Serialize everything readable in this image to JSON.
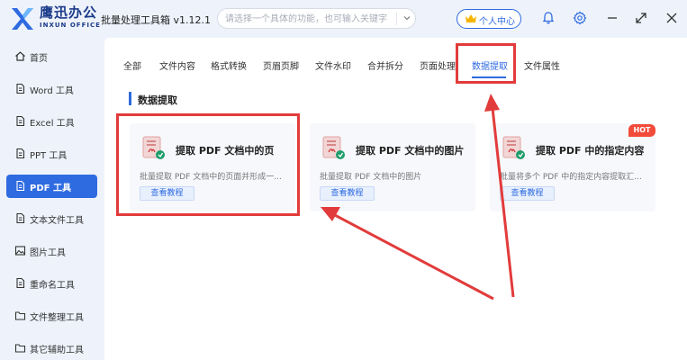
{
  "titlebar": {
    "brand_cn": "鹰迅办公",
    "brand_en": "INXUN OFFICE",
    "app_title": "批量处理工具箱 v1.12.1",
    "search_placeholder": "请选择一个具体的功能，也可输入关键字搜索！",
    "user_center": "个人中心"
  },
  "sidebar": {
    "items": [
      {
        "label": "首页",
        "icon": "home-icon"
      },
      {
        "label": "Word 工具",
        "icon": "document-icon"
      },
      {
        "label": "Excel 工具",
        "icon": "document-icon"
      },
      {
        "label": "PPT 工具",
        "icon": "document-icon"
      },
      {
        "label": "PDF 工具",
        "icon": "document-icon",
        "active": true
      },
      {
        "label": "文本文件工具",
        "icon": "document-icon"
      },
      {
        "label": "图片工具",
        "icon": "image-icon"
      },
      {
        "label": "重命名工具",
        "icon": "document-icon"
      },
      {
        "label": "文件整理工具",
        "icon": "folder-icon"
      },
      {
        "label": "其它辅助工具",
        "icon": "folder-icon"
      }
    ]
  },
  "tabs": [
    {
      "label": "全部"
    },
    {
      "label": "文件内容"
    },
    {
      "label": "格式转换"
    },
    {
      "label": "页眉页脚"
    },
    {
      "label": "文件水印"
    },
    {
      "label": "合并拆分"
    },
    {
      "label": "页面处理"
    },
    {
      "label": "数据提取",
      "active": true
    },
    {
      "label": "文件属性"
    }
  ],
  "section_title": "数据提取",
  "cards": [
    {
      "title": "提取 PDF 文档中的页",
      "desc": "批量提取 PDF 文档中的页面并形成一...",
      "button": "查看教程"
    },
    {
      "title": "提取 PDF 文档中的图片",
      "desc": "批量提取 PDF 文档中的图片",
      "button": "查看教程"
    },
    {
      "title": "提取 PDF 中的指定内容",
      "desc": "批量将多个 PDF 中的指定内容提取汇...",
      "button": "查看教程",
      "badge": "HOT"
    }
  ],
  "colors": {
    "accent": "#2f6be0",
    "annotation": "#e23b3b",
    "hot": "#f24b3a"
  }
}
